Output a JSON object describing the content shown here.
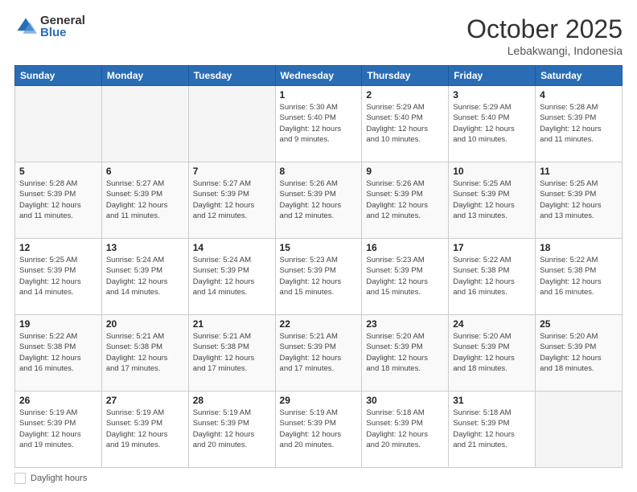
{
  "logo": {
    "general": "General",
    "blue": "Blue"
  },
  "header": {
    "month": "October 2025",
    "location": "Lebakwangi, Indonesia"
  },
  "weekdays": [
    "Sunday",
    "Monday",
    "Tuesday",
    "Wednesday",
    "Thursday",
    "Friday",
    "Saturday"
  ],
  "footer": {
    "label": "Daylight hours"
  },
  "weeks": [
    [
      {
        "day": "",
        "info": ""
      },
      {
        "day": "",
        "info": ""
      },
      {
        "day": "",
        "info": ""
      },
      {
        "day": "1",
        "info": "Sunrise: 5:30 AM\nSunset: 5:40 PM\nDaylight: 12 hours\nand 9 minutes."
      },
      {
        "day": "2",
        "info": "Sunrise: 5:29 AM\nSunset: 5:40 PM\nDaylight: 12 hours\nand 10 minutes."
      },
      {
        "day": "3",
        "info": "Sunrise: 5:29 AM\nSunset: 5:40 PM\nDaylight: 12 hours\nand 10 minutes."
      },
      {
        "day": "4",
        "info": "Sunrise: 5:28 AM\nSunset: 5:39 PM\nDaylight: 12 hours\nand 11 minutes."
      }
    ],
    [
      {
        "day": "5",
        "info": "Sunrise: 5:28 AM\nSunset: 5:39 PM\nDaylight: 12 hours\nand 11 minutes."
      },
      {
        "day": "6",
        "info": "Sunrise: 5:27 AM\nSunset: 5:39 PM\nDaylight: 12 hours\nand 11 minutes."
      },
      {
        "day": "7",
        "info": "Sunrise: 5:27 AM\nSunset: 5:39 PM\nDaylight: 12 hours\nand 12 minutes."
      },
      {
        "day": "8",
        "info": "Sunrise: 5:26 AM\nSunset: 5:39 PM\nDaylight: 12 hours\nand 12 minutes."
      },
      {
        "day": "9",
        "info": "Sunrise: 5:26 AM\nSunset: 5:39 PM\nDaylight: 12 hours\nand 12 minutes."
      },
      {
        "day": "10",
        "info": "Sunrise: 5:25 AM\nSunset: 5:39 PM\nDaylight: 12 hours\nand 13 minutes."
      },
      {
        "day": "11",
        "info": "Sunrise: 5:25 AM\nSunset: 5:39 PM\nDaylight: 12 hours\nand 13 minutes."
      }
    ],
    [
      {
        "day": "12",
        "info": "Sunrise: 5:25 AM\nSunset: 5:39 PM\nDaylight: 12 hours\nand 14 minutes."
      },
      {
        "day": "13",
        "info": "Sunrise: 5:24 AM\nSunset: 5:39 PM\nDaylight: 12 hours\nand 14 minutes."
      },
      {
        "day": "14",
        "info": "Sunrise: 5:24 AM\nSunset: 5:39 PM\nDaylight: 12 hours\nand 14 minutes."
      },
      {
        "day": "15",
        "info": "Sunrise: 5:23 AM\nSunset: 5:39 PM\nDaylight: 12 hours\nand 15 minutes."
      },
      {
        "day": "16",
        "info": "Sunrise: 5:23 AM\nSunset: 5:39 PM\nDaylight: 12 hours\nand 15 minutes."
      },
      {
        "day": "17",
        "info": "Sunrise: 5:22 AM\nSunset: 5:38 PM\nDaylight: 12 hours\nand 16 minutes."
      },
      {
        "day": "18",
        "info": "Sunrise: 5:22 AM\nSunset: 5:38 PM\nDaylight: 12 hours\nand 16 minutes."
      }
    ],
    [
      {
        "day": "19",
        "info": "Sunrise: 5:22 AM\nSunset: 5:38 PM\nDaylight: 12 hours\nand 16 minutes."
      },
      {
        "day": "20",
        "info": "Sunrise: 5:21 AM\nSunset: 5:38 PM\nDaylight: 12 hours\nand 17 minutes."
      },
      {
        "day": "21",
        "info": "Sunrise: 5:21 AM\nSunset: 5:38 PM\nDaylight: 12 hours\nand 17 minutes."
      },
      {
        "day": "22",
        "info": "Sunrise: 5:21 AM\nSunset: 5:39 PM\nDaylight: 12 hours\nand 17 minutes."
      },
      {
        "day": "23",
        "info": "Sunrise: 5:20 AM\nSunset: 5:39 PM\nDaylight: 12 hours\nand 18 minutes."
      },
      {
        "day": "24",
        "info": "Sunrise: 5:20 AM\nSunset: 5:39 PM\nDaylight: 12 hours\nand 18 minutes."
      },
      {
        "day": "25",
        "info": "Sunrise: 5:20 AM\nSunset: 5:39 PM\nDaylight: 12 hours\nand 18 minutes."
      }
    ],
    [
      {
        "day": "26",
        "info": "Sunrise: 5:19 AM\nSunset: 5:39 PM\nDaylight: 12 hours\nand 19 minutes."
      },
      {
        "day": "27",
        "info": "Sunrise: 5:19 AM\nSunset: 5:39 PM\nDaylight: 12 hours\nand 19 minutes."
      },
      {
        "day": "28",
        "info": "Sunrise: 5:19 AM\nSunset: 5:39 PM\nDaylight: 12 hours\nand 20 minutes."
      },
      {
        "day": "29",
        "info": "Sunrise: 5:19 AM\nSunset: 5:39 PM\nDaylight: 12 hours\nand 20 minutes."
      },
      {
        "day": "30",
        "info": "Sunrise: 5:18 AM\nSunset: 5:39 PM\nDaylight: 12 hours\nand 20 minutes."
      },
      {
        "day": "31",
        "info": "Sunrise: 5:18 AM\nSunset: 5:39 PM\nDaylight: 12 hours\nand 21 minutes."
      },
      {
        "day": "",
        "info": ""
      }
    ]
  ]
}
